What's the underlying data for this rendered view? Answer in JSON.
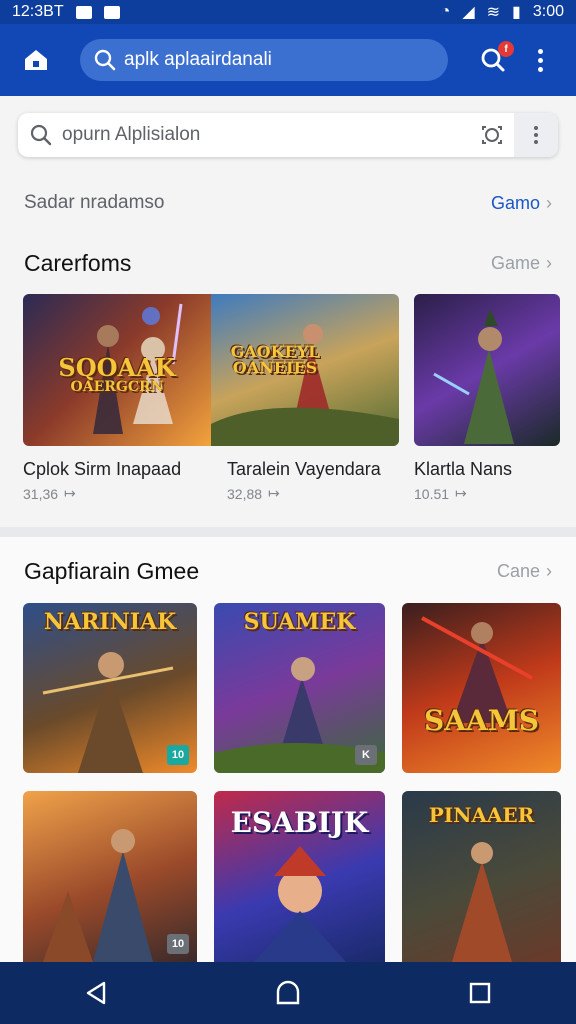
{
  "status_bar": {
    "time_left": "12:3BT",
    "time_right": "3:00"
  },
  "app_bar": {
    "search_text": "aplk aplaairdanali",
    "notification_count": "f"
  },
  "search": {
    "placeholder": "opurn Alplisialon"
  },
  "sub_header": {
    "title": "Sadar nradamso",
    "link": "Gamo"
  },
  "featured": {
    "title": "Carerfoms",
    "link": "Game",
    "banner_logo_line1": "SQOAAK",
    "banner_logo_line2": "OAERGCRN",
    "banner_logo2_line1": "GAOKEYL",
    "banner_logo2_line2": "OANEIES",
    "items": [
      {
        "title": "Cplok Sirm Inapaad",
        "meta": "31,36"
      },
      {
        "title": "Taralein Vayendara",
        "meta": "32,88"
      },
      {
        "title": "Klartla Nans",
        "meta": "10.51"
      }
    ]
  },
  "category": {
    "title": "Gapfiarain Gmee",
    "link": "Cane",
    "cards": [
      {
        "logo": "NARINIAK",
        "badge": "10"
      },
      {
        "logo": "SUAMEK",
        "badge": "K"
      },
      {
        "logo": "SAAMS",
        "badge": ""
      },
      {
        "logo": "",
        "badge": "10"
      },
      {
        "logo": "ESABIJK",
        "badge": ""
      },
      {
        "logo": "PINAAER",
        "badge": ""
      }
    ]
  }
}
